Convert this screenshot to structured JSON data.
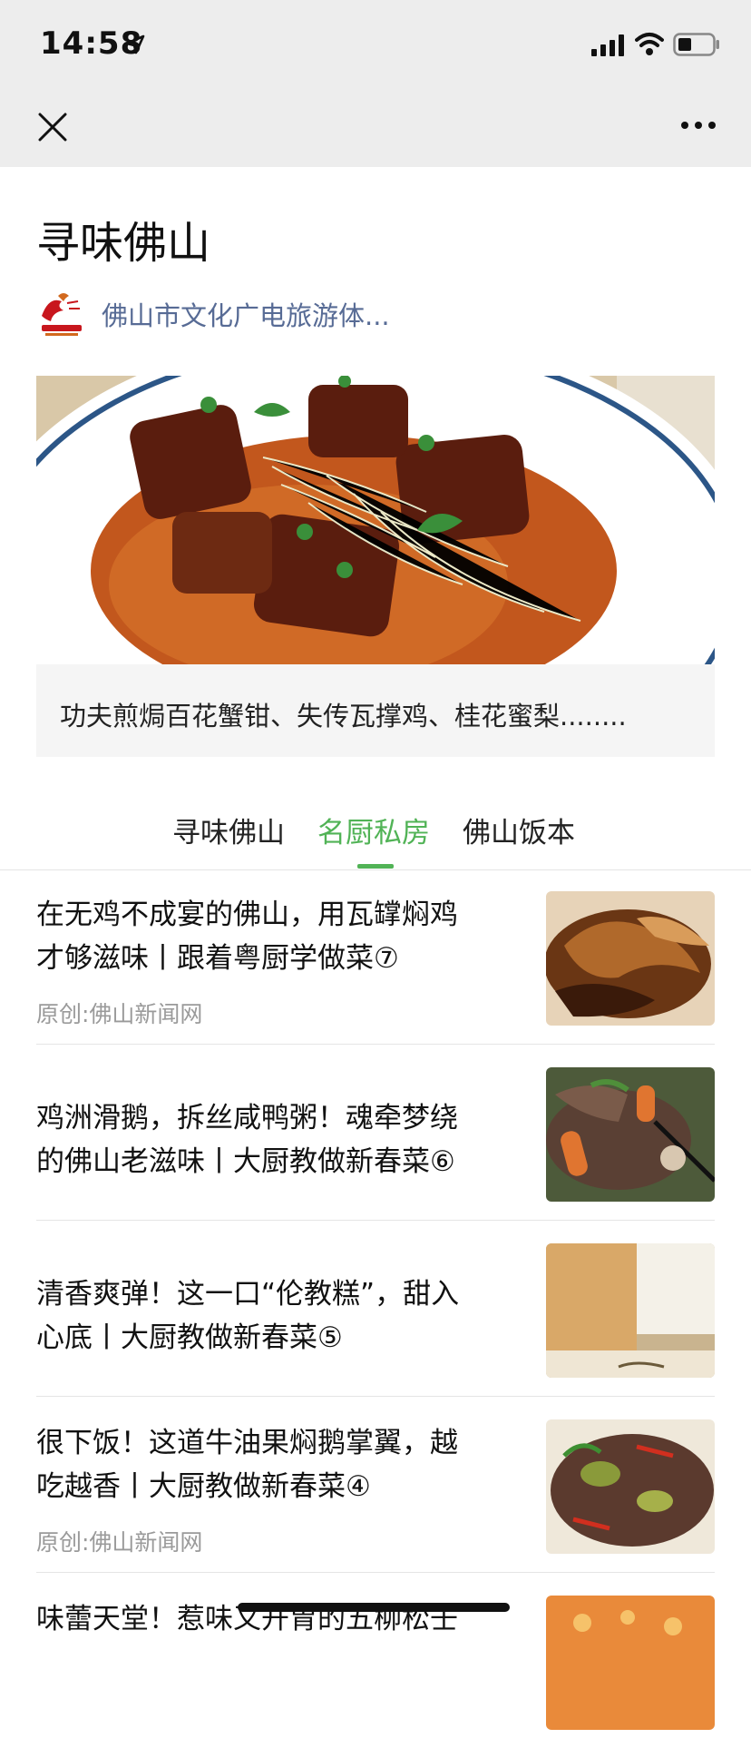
{
  "status": {
    "time": "14:58"
  },
  "page": {
    "title": "寻味佛山"
  },
  "publisher": {
    "name": "佛山市文化广电旅游体..."
  },
  "hero": {
    "caption": "功夫煎焗百花蟹钳、失传瓦撑鸡、桂花蜜梨........"
  },
  "tabs": [
    {
      "label": "寻味佛山",
      "active": false
    },
    {
      "label": "名厨私房",
      "active": true
    },
    {
      "label": "佛山饭本",
      "active": false
    }
  ],
  "articles": [
    {
      "title_l1": "在无鸡不成宴的佛山，用瓦罉焖鸡",
      "title_l2": "才够滋味丨跟着粤厨学做菜⑦",
      "source": "原创:佛山新闻网"
    },
    {
      "title_l1": "鸡洲滑鹅，拆丝咸鸭粥！魂牵梦绕",
      "title_l2": "的佛山老滋味丨大厨教做新春菜⑥",
      "source": ""
    },
    {
      "title_l1": "清香爽弹！这一口“伦教糕”，甜入",
      "title_l2": "心底丨大厨教做新春菜⑤",
      "source": ""
    },
    {
      "title_l1": "很下饭！这道牛油果焖鹅掌翼，越",
      "title_l2": "吃越香丨大厨教做新春菜④",
      "source": "原创:佛山新闻网"
    },
    {
      "title_l1": "味蕾天堂！惹味又开胃的五柳松壬",
      "title_l2": "",
      "source": ""
    }
  ],
  "colors": {
    "accent": "#51b356",
    "link": "#576b95"
  }
}
